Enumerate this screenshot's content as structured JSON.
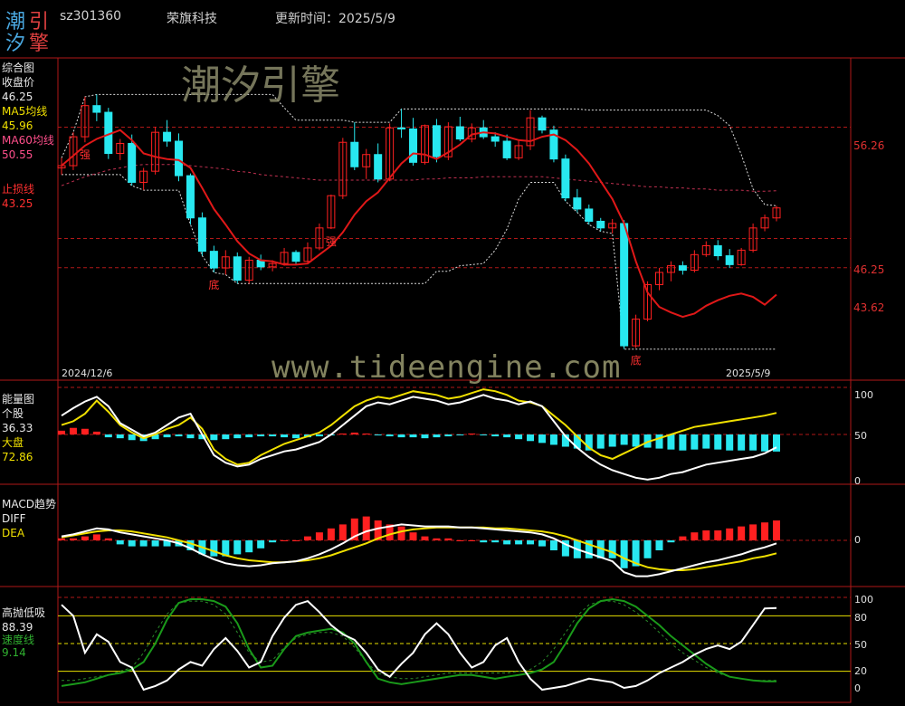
{
  "header": {
    "logo_chars": [
      "潮",
      "引",
      "汐",
      "擎"
    ],
    "code": "sz301360",
    "name": "荣旗科技",
    "update_label": "更新时间：2025/5/9"
  },
  "watermark": {
    "brand": "潮汐引擎",
    "url": "www.tideengine.com"
  },
  "panel_main": {
    "title": "综合图",
    "close_label": "收盘价",
    "close_value": "46.25",
    "ma5_label": "MA5均线",
    "ma5_value": "45.96",
    "ma60_label": "MA60均线",
    "ma60_value": "50.55",
    "stop_label": "止损线",
    "stop_value": "43.25",
    "date_start": "2024/12/6",
    "date_end": "2025/5/9",
    "right_ticks": [
      "56.26",
      "46.25",
      "43.62"
    ],
    "annotations": [
      {
        "text": "强",
        "idx": 2
      },
      {
        "text": "底",
        "idx": 13
      },
      {
        "text": "强",
        "idx": 23
      },
      {
        "text": "底",
        "idx": 49
      }
    ]
  },
  "panel_volume": {
    "title": "能量图",
    "stock_label": "个股",
    "stock_value": "36.33",
    "market_label": "大盘",
    "market_value": "72.86",
    "right_ticks": [
      "100",
      "50",
      "0"
    ]
  },
  "panel_macd": {
    "title": "MACD趋势",
    "diff_label": "DIFF",
    "dea_label": "DEA",
    "right_ticks": [
      "0"
    ]
  },
  "panel_osc": {
    "title": "高抛低吸",
    "value": "88.39",
    "speed_label": "速度线",
    "speed_value": "9.14",
    "right_ticks": [
      "100",
      "80",
      "50",
      "20",
      "0"
    ]
  },
  "colors": {
    "up": "#ff2020",
    "down": "#28e8f0",
    "ma_red": "#e01818",
    "white_line": "#ffffff",
    "yellow_line": "#f0e000",
    "green_line": "#1a9a1a",
    "grid_red": "#b01818"
  },
  "chart_data": {
    "type": "candlestick",
    "xlabel": "",
    "ylabel": "",
    "date_range": [
      "2024/12/6",
      "2025/5/9"
    ],
    "candles_ohlc": [
      [
        52.6,
        53.5,
        52.0,
        52.8
      ],
      [
        52.8,
        55.8,
        52.4,
        55.4
      ],
      [
        55.4,
        59.0,
        54.9,
        58.2
      ],
      [
        58.2,
        59.2,
        56.8,
        57.6
      ],
      [
        57.6,
        58.0,
        53.4,
        53.9
      ],
      [
        53.9,
        55.2,
        53.3,
        54.8
      ],
      [
        54.8,
        55.6,
        51.0,
        51.3
      ],
      [
        51.3,
        52.6,
        50.6,
        52.3
      ],
      [
        52.3,
        56.3,
        52.0,
        55.8
      ],
      [
        55.8,
        56.9,
        54.5,
        55.0
      ],
      [
        55.0,
        55.7,
        51.4,
        51.9
      ],
      [
        51.9,
        52.1,
        47.5,
        48.1
      ],
      [
        48.1,
        48.6,
        44.7,
        45.1
      ],
      [
        45.1,
        45.6,
        43.2,
        43.6
      ],
      [
        43.6,
        45.2,
        43.0,
        44.6
      ],
      [
        44.6,
        45.0,
        42.2,
        42.5
      ],
      [
        42.5,
        44.6,
        42.2,
        44.3
      ],
      [
        44.3,
        44.8,
        43.4,
        43.7
      ],
      [
        43.7,
        44.3,
        43.3,
        44.0
      ],
      [
        44.0,
        45.4,
        43.8,
        45.0
      ],
      [
        45.0,
        45.2,
        43.9,
        44.2
      ],
      [
        44.2,
        45.9,
        44.0,
        45.4
      ],
      [
        45.4,
        47.6,
        45.2,
        47.2
      ],
      [
        47.2,
        50.2,
        47.1,
        50.1
      ],
      [
        50.1,
        55.3,
        49.8,
        54.9
      ],
      [
        54.9,
        56.7,
        52.4,
        52.7
      ],
      [
        52.7,
        54.3,
        51.6,
        53.8
      ],
      [
        53.8,
        54.8,
        51.3,
        51.6
      ],
      [
        51.6,
        56.6,
        51.4,
        56.2
      ],
      [
        56.2,
        57.9,
        55.3,
        56.1
      ],
      [
        56.1,
        57.1,
        52.8,
        53.1
      ],
      [
        53.1,
        56.5,
        52.9,
        56.4
      ],
      [
        56.4,
        57.0,
        53.1,
        53.6
      ],
      [
        53.6,
        56.7,
        53.3,
        56.3
      ],
      [
        56.3,
        57.2,
        55.0,
        55.2
      ],
      [
        55.2,
        56.6,
        54.9,
        56.2
      ],
      [
        56.2,
        56.9,
        55.2,
        55.4
      ],
      [
        55.4,
        55.8,
        54.5,
        55.0
      ],
      [
        55.0,
        55.6,
        53.3,
        53.5
      ],
      [
        53.5,
        55.1,
        53.3,
        54.6
      ],
      [
        54.6,
        57.8,
        54.2,
        57.1
      ],
      [
        57.1,
        57.3,
        55.7,
        56.0
      ],
      [
        56.0,
        56.4,
        53.1,
        53.4
      ],
      [
        53.4,
        53.8,
        49.6,
        49.9
      ],
      [
        49.9,
        50.7,
        48.6,
        48.9
      ],
      [
        48.9,
        49.3,
        47.5,
        47.8
      ],
      [
        47.8,
        48.1,
        46.9,
        47.2
      ],
      [
        47.2,
        48.0,
        46.7,
        47.6
      ],
      [
        47.6,
        47.9,
        36.3,
        36.6
      ],
      [
        36.6,
        39.4,
        36.4,
        39.0
      ],
      [
        39.0,
        42.4,
        38.8,
        42.1
      ],
      [
        42.1,
        43.6,
        41.6,
        43.2
      ],
      [
        43.2,
        44.2,
        42.4,
        43.8
      ],
      [
        43.8,
        44.2,
        43.0,
        43.4
      ],
      [
        43.4,
        45.2,
        43.2,
        44.8
      ],
      [
        44.8,
        46.0,
        44.6,
        45.6
      ],
      [
        45.6,
        46.1,
        44.3,
        44.7
      ],
      [
        44.7,
        45.3,
        43.6,
        43.9
      ],
      [
        43.9,
        45.4,
        43.8,
        45.2
      ],
      [
        45.2,
        47.6,
        45.0,
        47.2
      ],
      [
        47.2,
        48.4,
        46.9,
        48.1
      ],
      [
        48.1,
        49.2,
        47.8,
        49.0
      ]
    ],
    "ma5": [
      52.8,
      53.7,
      54.6,
      55.2,
      55.6,
      56.0,
      55.1,
      53.9,
      53.6,
      53.4,
      53.3,
      52.6,
      50.8,
      48.9,
      47.5,
      46.0,
      44.9,
      44.3,
      44.2,
      43.9,
      43.9,
      44.0,
      44.8,
      45.6,
      46.8,
      48.4,
      49.6,
      50.4,
      51.7,
      53.0,
      53.9,
      53.8,
      53.4,
      54.0,
      54.7,
      55.6,
      55.8,
      55.7,
      55.4,
      55.1,
      55.0,
      55.4,
      55.6,
      55.1,
      54.2,
      53.0,
      51.4,
      49.8,
      47.6,
      44.2,
      41.4,
      40.1,
      39.6,
      39.2,
      39.5,
      40.2,
      40.7,
      41.1,
      41.3,
      41.0,
      40.3,
      41.2
    ],
    "ma60": [
      51.0,
      51.4,
      51.8,
      52.1,
      52.4,
      52.6,
      52.8,
      52.9,
      52.9,
      52.9,
      52.9,
      52.8,
      52.7,
      52.6,
      52.5,
      52.3,
      52.2,
      52.0,
      51.9,
      51.8,
      51.7,
      51.6,
      51.5,
      51.5,
      51.5,
      51.5,
      51.5,
      51.5,
      51.5,
      51.5,
      51.5,
      51.6,
      51.6,
      51.7,
      51.7,
      51.7,
      51.8,
      51.8,
      51.8,
      51.8,
      51.8,
      51.8,
      51.7,
      51.6,
      51.5,
      51.4,
      51.3,
      51.2,
      51.1,
      51.0,
      50.9,
      50.9,
      50.8,
      50.8,
      50.7,
      50.7,
      50.6,
      50.6,
      50.6,
      50.5,
      50.5,
      50.55
    ],
    "volume_white": [
      70,
      78,
      85,
      90,
      80,
      62,
      55,
      48,
      52,
      60,
      68,
      72,
      50,
      28,
      20,
      16,
      18,
      24,
      28,
      32,
      34,
      38,
      42,
      50,
      60,
      70,
      80,
      84,
      82,
      86,
      90,
      88,
      86,
      82,
      84,
      88,
      92,
      88,
      86,
      82,
      85,
      80,
      64,
      48,
      36,
      26,
      18,
      12,
      8,
      4,
      2,
      4,
      8,
      10,
      14,
      18,
      20,
      22,
      24,
      26,
      30,
      36.33
    ],
    "volume_yellow": [
      60,
      64,
      72,
      86,
      74,
      60,
      52,
      46,
      50,
      56,
      60,
      68,
      56,
      34,
      24,
      18,
      20,
      28,
      34,
      40,
      44,
      48,
      52,
      60,
      70,
      80,
      86,
      90,
      88,
      92,
      96,
      94,
      92,
      88,
      90,
      94,
      98,
      96,
      92,
      86,
      84,
      80,
      70,
      60,
      48,
      36,
      28,
      24,
      30,
      36,
      42,
      46,
      50,
      54,
      58,
      60,
      62,
      64,
      66,
      68,
      70,
      72.86
    ],
    "volume_bars": [
      8,
      14,
      12,
      6,
      -6,
      -8,
      -12,
      -14,
      -10,
      -6,
      -4,
      -8,
      -10,
      -12,
      -10,
      -8,
      -6,
      -4,
      -4,
      -6,
      -8,
      -6,
      -4,
      -2,
      2,
      4,
      2,
      -2,
      -4,
      -6,
      -6,
      -8,
      -6,
      -4,
      -2,
      2,
      -2,
      -4,
      -6,
      -10,
      -14,
      -18,
      -22,
      -26,
      -30,
      -34,
      -30,
      -26,
      -22,
      -26,
      -28,
      -30,
      -32,
      -34,
      -32,
      -30,
      -32,
      -34,
      -34,
      -34,
      -36,
      -36.33
    ],
    "diff": [
      0.4,
      0.6,
      0.9,
      1.2,
      1.1,
      0.8,
      0.6,
      0.4,
      0.2,
      0.0,
      -0.3,
      -0.8,
      -1.4,
      -1.9,
      -2.3,
      -2.5,
      -2.6,
      -2.5,
      -2.3,
      -2.2,
      -2.1,
      -1.8,
      -1.4,
      -0.9,
      -0.3,
      0.4,
      0.9,
      1.2,
      1.4,
      1.6,
      1.5,
      1.4,
      1.4,
      1.4,
      1.3,
      1.3,
      1.2,
      1.1,
      1.0,
      0.9,
      0.8,
      0.6,
      0.2,
      -0.4,
      -0.9,
      -1.3,
      -1.7,
      -2.1,
      -3.2,
      -3.6,
      -3.6,
      -3.4,
      -3.1,
      -2.8,
      -2.5,
      -2.2,
      -2.0,
      -1.7,
      -1.4,
      -1.0,
      -0.7,
      -0.3
    ],
    "dea": [
      0.3,
      0.5,
      0.7,
      0.9,
      1.0,
      1.0,
      0.9,
      0.7,
      0.5,
      0.3,
      0.0,
      -0.3,
      -0.7,
      -1.1,
      -1.5,
      -1.8,
      -2.0,
      -2.1,
      -2.2,
      -2.2,
      -2.1,
      -2.0,
      -1.8,
      -1.5,
      -1.1,
      -0.7,
      -0.3,
      0.2,
      0.6,
      0.9,
      1.1,
      1.2,
      1.3,
      1.3,
      1.3,
      1.3,
      1.3,
      1.2,
      1.2,
      1.1,
      1.0,
      0.9,
      0.7,
      0.4,
      0.0,
      -0.4,
      -0.8,
      -1.2,
      -1.8,
      -2.3,
      -2.7,
      -2.9,
      -3.0,
      -3.0,
      -2.9,
      -2.7,
      -2.5,
      -2.3,
      -2.1,
      -1.8,
      -1.6,
      -1.3
    ],
    "macd_bar": [
      0.2,
      0.2,
      0.4,
      0.6,
      0.2,
      -0.4,
      -0.6,
      -0.6,
      -0.6,
      -0.6,
      -0.6,
      -1.0,
      -1.4,
      -1.6,
      -1.6,
      -1.4,
      -1.2,
      -0.8,
      -0.2,
      0.0,
      0.0,
      0.4,
      0.8,
      1.2,
      1.6,
      2.2,
      2.4,
      2.0,
      1.6,
      1.4,
      0.8,
      0.4,
      0.2,
      0.2,
      0.0,
      0.0,
      -0.2,
      -0.2,
      -0.4,
      -0.4,
      -0.4,
      -0.6,
      -1.0,
      -1.6,
      -1.8,
      -1.8,
      -1.8,
      -1.8,
      -2.8,
      -2.6,
      -1.8,
      -1.0,
      -0.2,
      0.4,
      0.8,
      1.0,
      1.0,
      1.2,
      1.4,
      1.6,
      1.8,
      2.0
    ],
    "osc_white": [
      92,
      80,
      40,
      60,
      52,
      30,
      24,
      0,
      4,
      10,
      22,
      30,
      26,
      44,
      56,
      42,
      24,
      30,
      58,
      78,
      92,
      96,
      84,
      70,
      60,
      54,
      40,
      22,
      14,
      28,
      40,
      60,
      72,
      60,
      40,
      24,
      30,
      48,
      56,
      30,
      12,
      0,
      2,
      4,
      8,
      12,
      10,
      8,
      2,
      4,
      10,
      18,
      24,
      30,
      38,
      44,
      48,
      44,
      52,
      70,
      88,
      88.39
    ],
    "osc_green": [
      4,
      6,
      8,
      12,
      16,
      18,
      22,
      30,
      50,
      76,
      94,
      98,
      98,
      96,
      90,
      72,
      44,
      24,
      26,
      44,
      58,
      62,
      64,
      66,
      62,
      50,
      30,
      12,
      8,
      6,
      8,
      10,
      12,
      14,
      16,
      16,
      14,
      12,
      14,
      16,
      18,
      22,
      30,
      50,
      72,
      88,
      96,
      98,
      96,
      90,
      80,
      70,
      58,
      48,
      38,
      28,
      20,
      14,
      12,
      10,
      9,
      9.14
    ],
    "osc_green_dash": [
      10,
      10,
      12,
      14,
      16,
      20,
      24,
      40,
      62,
      82,
      94,
      96,
      96,
      92,
      82,
      62,
      40,
      30,
      32,
      46,
      56,
      60,
      62,
      62,
      58,
      46,
      30,
      18,
      14,
      12,
      12,
      14,
      16,
      18,
      18,
      18,
      18,
      18,
      18,
      20,
      22,
      30,
      44,
      62,
      80,
      92,
      96,
      96,
      92,
      84,
      74,
      62,
      50,
      40,
      32,
      24,
      18,
      14,
      12,
      10,
      10,
      10
    ],
    "ylim_main": [
      34,
      62
    ],
    "grid": false
  }
}
